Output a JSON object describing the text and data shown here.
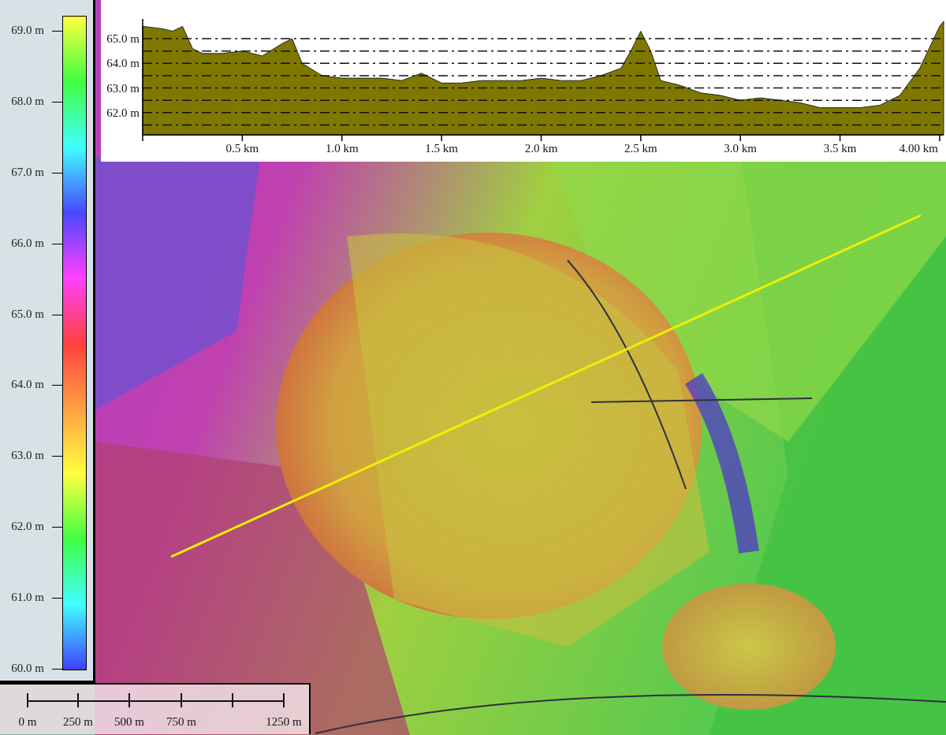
{
  "legend": {
    "labels": [
      "69.0 m",
      "68.0 m",
      "67.0 m",
      "66.0 m",
      "65.0 m",
      "64.0 m",
      "63.0 m",
      "62.0 m",
      "61.0 m",
      "60.0 m"
    ]
  },
  "profile": {
    "chart_data": {
      "type": "area",
      "x": [
        0,
        0.1,
        0.15,
        0.2,
        0.25,
        0.3,
        0.4,
        0.5,
        0.6,
        0.7,
        0.75,
        0.8,
        0.9,
        1.0,
        1.1,
        1.2,
        1.3,
        1.4,
        1.5,
        1.6,
        1.7,
        1.8,
        1.9,
        2.0,
        2.1,
        2.2,
        2.3,
        2.4,
        2.45,
        2.5,
        2.55,
        2.6,
        2.7,
        2.8,
        2.9,
        3.0,
        3.1,
        3.2,
        3.3,
        3.4,
        3.5,
        3.6,
        3.7,
        3.8,
        3.9,
        4.0,
        4.02
      ],
      "series": [
        {
          "color": "#7f7800",
          "values": [
            65.5,
            65.4,
            65.3,
            65.5,
            64.6,
            64.4,
            64.4,
            64.5,
            64.3,
            64.8,
            65.0,
            64.0,
            63.5,
            63.4,
            63.4,
            63.4,
            63.3,
            63.6,
            63.2,
            63.2,
            63.3,
            63.3,
            63.3,
            63.4,
            63.3,
            63.3,
            63.5,
            63.8,
            64.5,
            65.3,
            64.5,
            63.3,
            63.1,
            62.8,
            62.7,
            62.5,
            62.6,
            62.5,
            62.4,
            62.2,
            62.2,
            62.2,
            62.3,
            62.7,
            63.8,
            65.5,
            65.7
          ]
        }
      ],
      "xlim": [
        0,
        4.02
      ],
      "ylim": [
        61.1,
        65.8
      ],
      "grid": true,
      "xticks": [
        {
          "value": 0.5,
          "label": "0.5 km"
        },
        {
          "value": 1.0,
          "label": "1.0 km"
        },
        {
          "value": 1.5,
          "label": "1.5 km"
        },
        {
          "value": 2.0,
          "label": "2.0 km"
        },
        {
          "value": 2.5,
          "label": "2.5 km"
        },
        {
          "value": 3.0,
          "label": "3.0 km"
        },
        {
          "value": 3.5,
          "label": "3.5 km"
        },
        {
          "value": 4.0,
          "label": "4.00 km"
        }
      ],
      "yticks": [
        {
          "value": 62,
          "label": "62.0 m"
        },
        {
          "value": 63,
          "label": "63.0 m"
        },
        {
          "value": 64,
          "label": "64.0 m"
        },
        {
          "value": 65,
          "label": "65.0 m"
        }
      ]
    }
  },
  "scale_bar": {
    "labels": [
      "0 m",
      "250 m",
      "500 m",
      "750 m",
      "1250 m"
    ]
  }
}
